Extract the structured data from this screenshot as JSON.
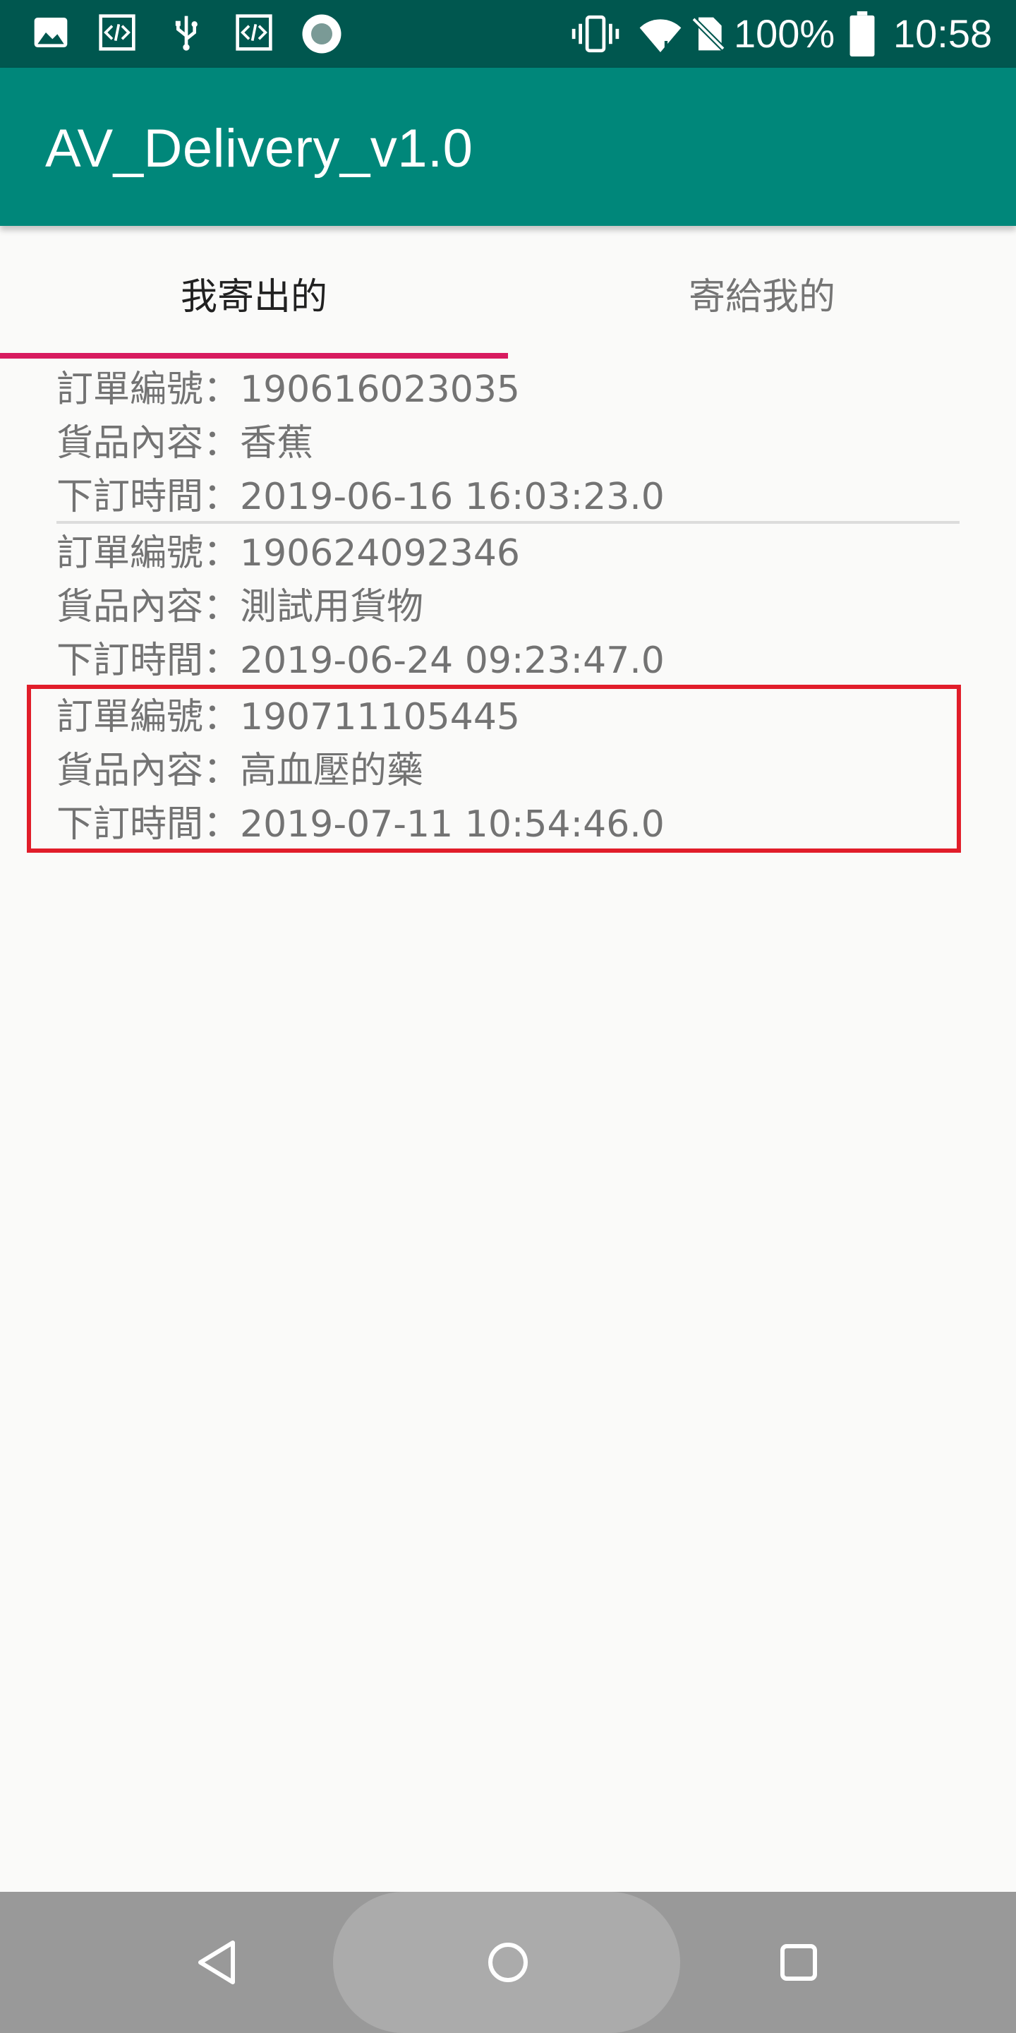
{
  "status_bar": {
    "battery": "100%",
    "time": "10:58",
    "icons": [
      "image-icon",
      "code-icon",
      "usb-icon",
      "code-icon",
      "record-icon",
      "vibrate-icon",
      "wifi-icon",
      "no-sim-icon",
      "battery-icon"
    ]
  },
  "app_bar": {
    "title": "AV_Delivery_v1.0"
  },
  "tabs": [
    {
      "label": "我寄出的",
      "selected": true
    },
    {
      "label": "寄給我的",
      "selected": false
    }
  ],
  "orders": [
    {
      "number": "訂單編號：190616023035",
      "content": "貨品內容：香蕉",
      "time": "下訂時間：2019-06-16 16:03:23.0"
    },
    {
      "number": "訂單編號：190624092346",
      "content": "貨品內容：測試用貨物",
      "time": "下訂時間：2019-06-24 09:23:47.0"
    },
    {
      "number": "訂單編號：190711105445",
      "content": "貨品內容：高血壓的藥",
      "time": "下訂時間：2019-07-11 10:54:46.0"
    }
  ],
  "colors": {
    "status_bar": "#00574f",
    "app_bar": "#00877a",
    "tab_indicator": "#d81b60",
    "highlight": "#e11d2a",
    "nav_bar": "#999999"
  },
  "nav": [
    "back-icon",
    "home-icon",
    "recents-icon"
  ]
}
